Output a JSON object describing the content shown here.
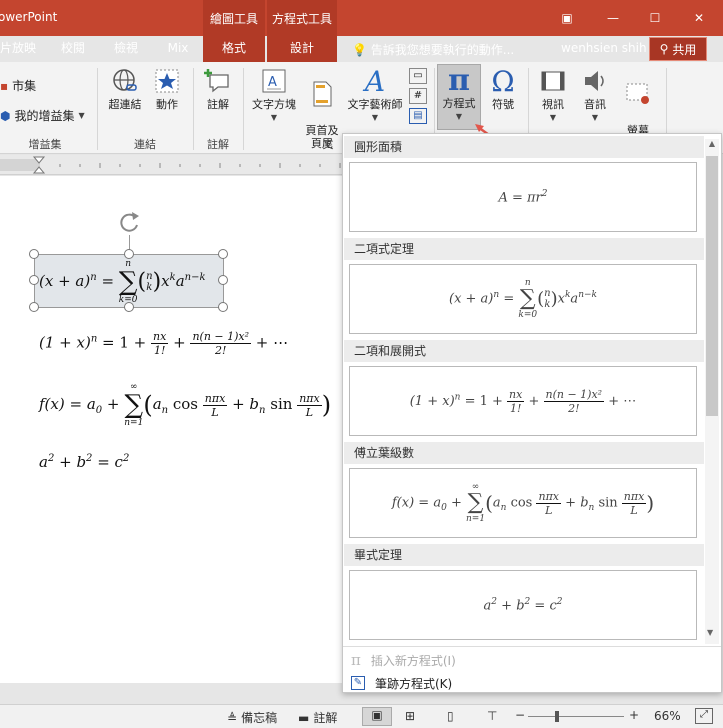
{
  "app_title": "owerPoint",
  "context_groups": [
    {
      "title": "繪圖工具",
      "tab": "格式"
    },
    {
      "title": "方程式工具",
      "tab": "設計"
    }
  ],
  "window_controls": {
    "options": "▣",
    "minimize": "—",
    "maximize": "☐",
    "close": "✕"
  },
  "tabs": [
    "片放映",
    "校閱",
    "檢視",
    "Mix"
  ],
  "tell_me": "告訴我您想要執行的動作...",
  "user_name": "wenhsien shih",
  "share_label": "共用",
  "ribbon": {
    "addins": {
      "store": "市集",
      "my_addins": "我的增益集",
      "group": "增益集"
    },
    "links": {
      "hyperlink": "超連結",
      "action": "動作",
      "group": "連結"
    },
    "comments": {
      "comment": "註解",
      "group": "註解"
    },
    "text": {
      "textbox": "文字方塊",
      "header_footer": "頁首及\n頁尾",
      "wordart": "文字藝術師",
      "group": "文"
    },
    "symbols": {
      "equation": "方程式",
      "symbol": "符號"
    },
    "media": {
      "video": "視訊",
      "audio": "音訊",
      "screen_rec": "螢幕\n錄製"
    }
  },
  "document": {
    "eq1": {
      "left": "(x + a)",
      "sup": "n",
      "eq": " = ",
      "upper": "n",
      "lower": "k=0",
      "binom_top": "n",
      "binom_bot": "k",
      "tail": "x",
      "tail_sup1": "k",
      "tail2": "a",
      "tail_sup2": "n−k"
    },
    "eq2": {
      "left": "(1 + x)",
      "sup": "n",
      "mid": " = 1 + ",
      "f1_num": "nx",
      "f1_den": "1!",
      "plus": " + ",
      "f2_num": "n(n − 1)x²",
      "f2_den": "2!",
      "tail": " + ⋯"
    },
    "eq3": {
      "left": "f(x) = a",
      "sub": "0",
      "plus": " + ",
      "upper": "∞",
      "lower": "n=1",
      "open": "(",
      "an": "a",
      "an_sub": "n",
      "cos": " cos ",
      "f1_num": "nπx",
      "f1_den": "L",
      "plus2": " + ",
      "bn": "b",
      "bn_sub": "n",
      "sin": " sin ",
      "f2_num": "nπx",
      "f2_den": "L",
      "close": ")"
    },
    "eq4": {
      "a": "a",
      "a_sup": "2",
      "plus": " + ",
      "b": "b",
      "b_sup": "2",
      "eq": " = ",
      "c": "c",
      "c_sup": "2"
    }
  },
  "gallery": {
    "sections": [
      {
        "title": "圓形面積",
        "eq": "A = πr",
        "sup": "2"
      },
      {
        "title": "二項式定理"
      },
      {
        "title": "二項和展開式"
      },
      {
        "title": "傅立葉級數"
      },
      {
        "title": "畢式定理"
      }
    ],
    "insert_new": "插入新方程式(I)",
    "ink_equation": "筆跡方程式(K)"
  },
  "status": {
    "notes": "備忘稿",
    "comments": "註解",
    "zoom": "66%"
  }
}
